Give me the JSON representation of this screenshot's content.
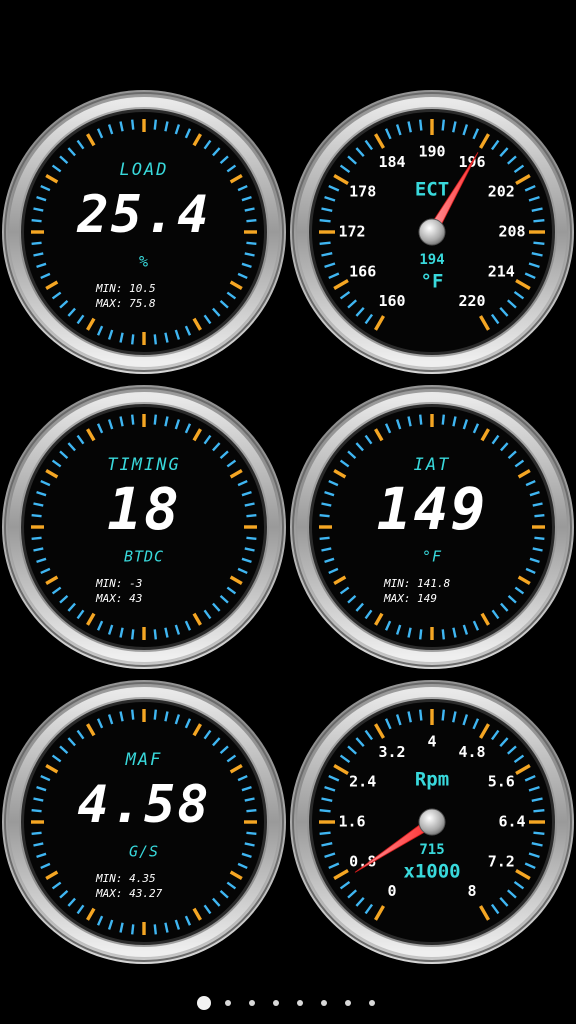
{
  "gauges": [
    {
      "type": "digital",
      "title": "LOAD",
      "value": "25.4",
      "unit": "%",
      "min_label": "MIN: 10.5",
      "max_label": "MAX: 75.8"
    },
    {
      "type": "analog",
      "title": "ECT",
      "value": "194",
      "unit": "°F",
      "tick_labels": [
        "160",
        "166",
        "172",
        "178",
        "184",
        "190",
        "196",
        "202",
        "208",
        "214",
        "220"
      ],
      "scale_min": 160,
      "scale_max": 220,
      "needle_value": 196
    },
    {
      "type": "digital",
      "title": "TIMING",
      "value": "18",
      "unit": "BTDC",
      "min_label": "MIN: -3",
      "max_label": "MAX: 43"
    },
    {
      "type": "digital",
      "title": "IAT",
      "value": "149",
      "unit": "°F",
      "min_label": "MIN: 141.8",
      "max_label": "MAX: 149"
    },
    {
      "type": "digital",
      "title": "MAF",
      "value": "4.58",
      "unit": "G/S",
      "min_label": "MIN: 4.35",
      "max_label": "MAX: 43.27"
    },
    {
      "type": "analog",
      "title": "Rpm",
      "value": "715",
      "unit": "x1000",
      "tick_labels": [
        "0",
        "0.8",
        "1.6",
        "2.4",
        "3.2",
        "4",
        "4.8",
        "5.6",
        "6.4",
        "7.2",
        "8"
      ],
      "scale_min": 0,
      "scale_max": 8,
      "needle_value": 0.715
    }
  ],
  "pager": {
    "page_count": 8,
    "active_index": 0
  },
  "colors": {
    "title_cyan": "#39d9dc",
    "value_white": "#ffffff",
    "tick_orange": "#f5a623",
    "tick_blue": "#3fb6f2",
    "needle_red": "#ff3b3b",
    "bezel_silver": "#c7c7c7",
    "face": "#050505"
  }
}
